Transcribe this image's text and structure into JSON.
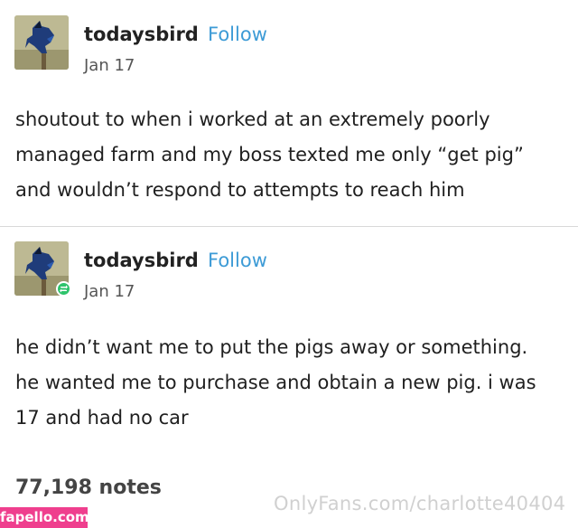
{
  "posts": [
    {
      "username": "todaysbird",
      "follow_label": "Follow",
      "date": "Jan 17",
      "avatar_icon": "blue-jay-avatar",
      "lines": [
        "shoutout to when i worked at an extremely poorly",
        "managed farm and my boss texted me only “get pig”",
        "and wouldn’t respond to attempts to reach him"
      ]
    },
    {
      "username": "todaysbird",
      "follow_label": "Follow",
      "date": "Jan 17",
      "avatar_icon": "blue-jay-avatar",
      "badge_icon": "reblog-icon",
      "lines": [
        "he didn’t want me to put the pigs away or something.",
        "he wanted me to purchase and obtain a new pig. i was",
        "17 and had no car"
      ]
    }
  ],
  "notes": "77,198 notes",
  "watermarks": {
    "right": "OnlyFans.com/charlotte40404",
    "left": "fapello.com"
  },
  "colors": {
    "follow": "#3d9bd6",
    "reblog_badge": "#2ec36b",
    "watermark_badge": "#ef3f8e"
  }
}
